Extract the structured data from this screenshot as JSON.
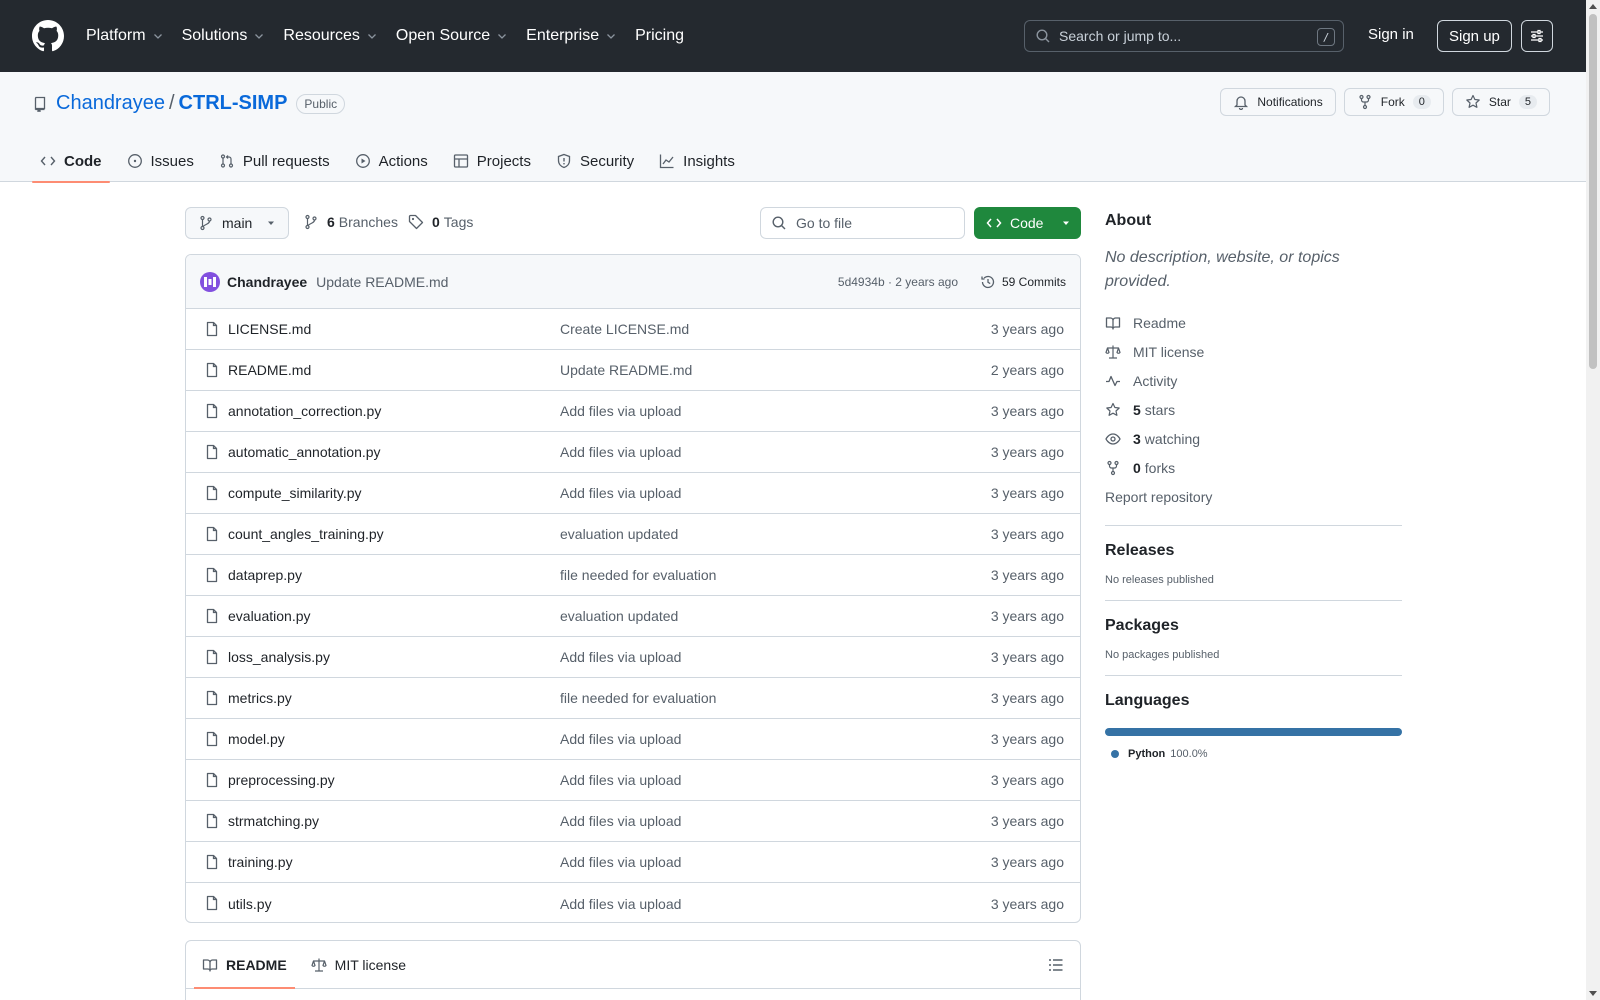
{
  "header": {
    "nav": [
      {
        "label": "Platform",
        "dropdown": true
      },
      {
        "label": "Solutions",
        "dropdown": true
      },
      {
        "label": "Resources",
        "dropdown": true
      },
      {
        "label": "Open Source",
        "dropdown": true
      },
      {
        "label": "Enterprise",
        "dropdown": true
      },
      {
        "label": "Pricing",
        "dropdown": false
      }
    ],
    "search_placeholder": "Search or jump to...",
    "search_shortcut": "/",
    "signin": "Sign in",
    "signup": "Sign up"
  },
  "repo": {
    "owner": "Chandrayee",
    "separator": "/",
    "name": "CTRL-SIMP",
    "visibility": "Public",
    "notifications_label": "Notifications",
    "fork_label": "Fork",
    "fork_count": "0",
    "star_label": "Star",
    "star_count": "5",
    "tabs": [
      {
        "label": "Code",
        "icon": "code-icon",
        "active": true
      },
      {
        "label": "Issues",
        "icon": "issue-icon",
        "active": false
      },
      {
        "label": "Pull requests",
        "icon": "pull-request-icon",
        "active": false
      },
      {
        "label": "Actions",
        "icon": "play-icon",
        "active": false
      },
      {
        "label": "Projects",
        "icon": "table-icon",
        "active": false
      },
      {
        "label": "Security",
        "icon": "shield-icon",
        "active": false
      },
      {
        "label": "Insights",
        "icon": "graph-icon",
        "active": false
      }
    ]
  },
  "toolbar": {
    "branch": "main",
    "branches_count": "6",
    "branches_label": "Branches",
    "tags_count": "0",
    "tags_label": "Tags",
    "goto_placeholder": "Go to file",
    "code_label": "Code"
  },
  "latest_commit": {
    "author": "Chandrayee",
    "message": "Update README.md",
    "meta": "5d4934b · 2 years ago",
    "commits_label": "59 Commits"
  },
  "files": [
    {
      "name": "LICENSE.md",
      "commit": "Create LICENSE.md",
      "time": "3 years ago"
    },
    {
      "name": "README.md",
      "commit": "Update README.md",
      "time": "2 years ago"
    },
    {
      "name": "annotation_correction.py",
      "commit": "Add files via upload",
      "time": "3 years ago"
    },
    {
      "name": "automatic_annotation.py",
      "commit": "Add files via upload",
      "time": "3 years ago"
    },
    {
      "name": "compute_similarity.py",
      "commit": "Add files via upload",
      "time": "3 years ago"
    },
    {
      "name": "count_angles_training.py",
      "commit": "evaluation updated",
      "time": "3 years ago"
    },
    {
      "name": "dataprep.py",
      "commit": "file needed for evaluation",
      "time": "3 years ago"
    },
    {
      "name": "evaluation.py",
      "commit": "evaluation updated",
      "time": "3 years ago"
    },
    {
      "name": "loss_analysis.py",
      "commit": "Add files via upload",
      "time": "3 years ago"
    },
    {
      "name": "metrics.py",
      "commit": "file needed for evaluation",
      "time": "3 years ago"
    },
    {
      "name": "model.py",
      "commit": "Add files via upload",
      "time": "3 years ago"
    },
    {
      "name": "preprocessing.py",
      "commit": "Add files via upload",
      "time": "3 years ago"
    },
    {
      "name": "strmatching.py",
      "commit": "Add files via upload",
      "time": "3 years ago"
    },
    {
      "name": "training.py",
      "commit": "Add files via upload",
      "time": "3 years ago"
    },
    {
      "name": "utils.py",
      "commit": "Add files via upload",
      "time": "3 years ago"
    }
  ],
  "readme_tabs": {
    "readme": "README",
    "license": "MIT license"
  },
  "sidebar": {
    "about_title": "About",
    "about_desc": "No description, website, or topics provided.",
    "readme": "Readme",
    "license": "MIT license",
    "activity": "Activity",
    "stars_count": "5",
    "stars_label": "stars",
    "watching_count": "3",
    "watching_label": "watching",
    "forks_count": "0",
    "forks_label": "forks",
    "report": "Report repository",
    "releases_title": "Releases",
    "releases_text": "No releases published",
    "packages_title": "Packages",
    "packages_text": "No packages published",
    "languages_title": "Languages",
    "language": {
      "name": "Python",
      "percent": "100.0%",
      "color": "#3572a5"
    }
  },
  "colors": {
    "header_bg": "#24292f",
    "link": "#0969da",
    "primary_button": "#1f883d",
    "tab_underline": "#fd8c73"
  }
}
